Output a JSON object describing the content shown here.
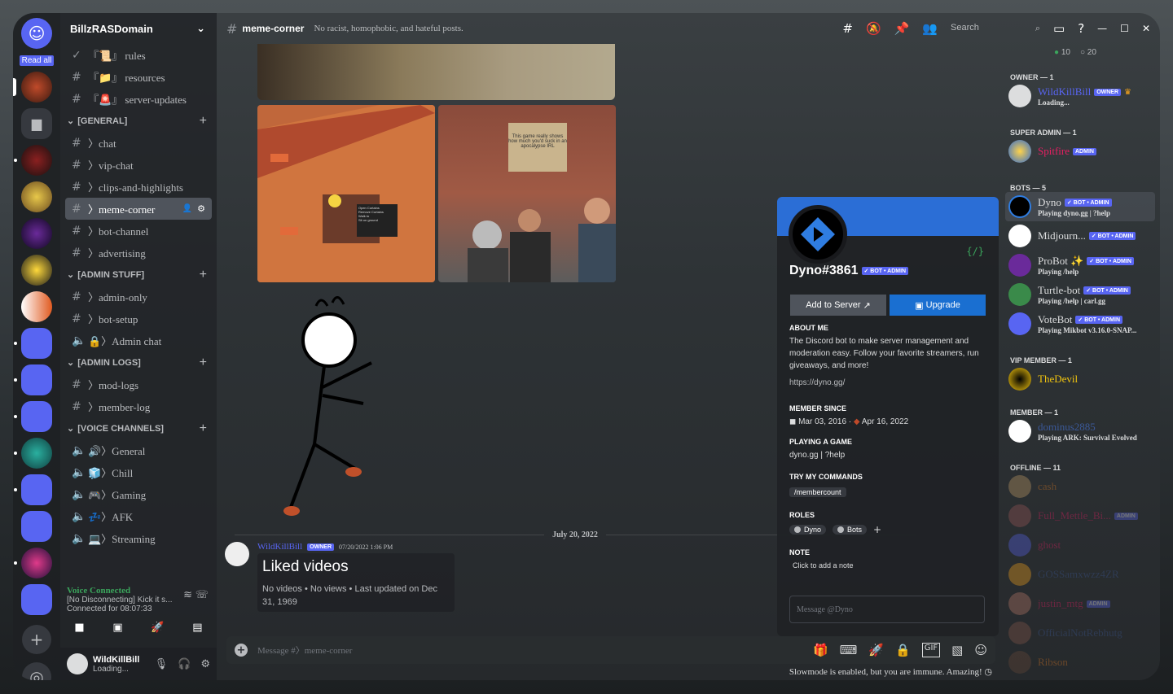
{
  "server_name": "BillzRASDomain",
  "read_all": "Read all",
  "channels_top": [
    {
      "icon": "✓",
      "label": "『📜』 rules"
    },
    {
      "icon": "#",
      "label": "『📁』 resources"
    },
    {
      "icon": "#",
      "label": "『🚨』 server-updates"
    }
  ],
  "cat_general": "[GENERAL]",
  "general": [
    "〉chat",
    "〉vip-chat",
    "〉clips-and-highlights",
    "〉meme-corner",
    "〉bot-channel",
    "〉advertising"
  ],
  "cat_admin": "[ADMIN STUFF]",
  "admin": [
    "〉admin-only",
    "〉bot-setup",
    "🔒〉Admin chat"
  ],
  "cat_logs": "[ADMIN LOGS]",
  "logs": [
    "〉mod-logs",
    "〉member-log"
  ],
  "cat_voice": "[VOICE CHANNELS]",
  "voice_channels": [
    "🔊〉General",
    "🧊〉Chill",
    "🎮〉Gaming",
    "💤〉AFK",
    "💻〉Streaming"
  ],
  "voice": {
    "status": "Voice Connected",
    "line1": "[No Disconnecting] Kick it s...",
    "line2": "Connected for 08:07:33"
  },
  "user": {
    "name": "WildKillBill",
    "status": "Loading..."
  },
  "topbar": {
    "channel": "meme-corner",
    "topic": "No racist, homophobic, and hateful posts.",
    "search": "Search"
  },
  "img_menu": [
    "Open Curtains",
    "Remove Curtains",
    "Walk to",
    "Sit on ground"
  ],
  "sign_text": "This game really shows how much you'd suck in an apocalypse IRL",
  "date_divider": "July 20, 2022",
  "message": {
    "author": "WildKillBill",
    "tag": "OWNER",
    "time": "07/20/2022 1:06 PM",
    "card_title": "Liked videos",
    "card_sub": "No videos • No views • Last updated on Dec 31, 1969"
  },
  "composer": {
    "placeholder": "Message #〉meme-corner",
    "slowmode": "Slowmode is enabled, but you are immune. Amazing!"
  },
  "profile": {
    "name": "Dyno#3861",
    "tag": "✓ BOT • ADMIN",
    "add": "Add to Server",
    "upgrade": "Upgrade",
    "about_t": "ABOUT ME",
    "about": "The Discord bot to make server management and moderation easy. Follow your favorite streamers, run giveaways, and more!",
    "link": "https://dyno.gg/",
    "since_t": "MEMBER SINCE",
    "since1": "Mar 03, 2016",
    "since2": "Apr 16, 2022",
    "game_t": "PLAYING A GAME",
    "game": "dyno.gg | ?help",
    "cmd_t": "TRY MY COMMANDS",
    "cmd": "/membercount",
    "roles_t": "ROLES",
    "roles": [
      "Dyno",
      "Bots"
    ],
    "note_t": "NOTE",
    "note": "Click to add a note",
    "msg": "Message @Dyno"
  },
  "counts": {
    "online": "10",
    "total": "20"
  },
  "members": {
    "owner_h": "OWNER — 1",
    "super_h": "SUPER ADMIN — 1",
    "bots_h": "BOTS — 5",
    "vip_h": "VIP MEMBER — 1",
    "member_h": "MEMBER — 1",
    "offline_h": "OFFLINE — 11",
    "owner": {
      "name": "WildKillBill",
      "tag": "OWNER",
      "status": "Loading..."
    },
    "super": {
      "name": "Spitfire",
      "tag": "ADMIN"
    },
    "bots": [
      {
        "name": "Dyno",
        "tag": "✓ BOT • ADMIN",
        "status": "Playing dyno.gg | ?help"
      },
      {
        "name": "Midjourn...",
        "tag": "✓ BOT • ADMIN",
        "status": ""
      },
      {
        "name": "ProBot ✨",
        "tag": "✓ BOT • ADMIN",
        "status": "Playing /help"
      },
      {
        "name": "Turtle-bot",
        "tag": "✓ BOT • ADMIN",
        "status": "Playing /help | carl.gg"
      },
      {
        "name": "VoteBot",
        "tag": "✓ BOT • ADMIN",
        "status": "Playing Mikbot v3.16.0-SNAP..."
      }
    ],
    "vip": {
      "name": "TheDevil"
    },
    "member": {
      "name": "dominus2885",
      "status": "Playing ARK: Survival Evolved"
    },
    "offline": [
      {
        "name": "cash",
        "tag": ""
      },
      {
        "name": "Full_Mettle_Bi...",
        "tag": "ADMIN"
      },
      {
        "name": "ghost",
        "tag": ""
      },
      {
        "name": "GOSSamxwzz4ZR",
        "tag": ""
      },
      {
        "name": "justin_mtg",
        "tag": "ADMIN"
      },
      {
        "name": "OfficialNotRebhutg",
        "tag": ""
      },
      {
        "name": "Ribson",
        "tag": ""
      }
    ]
  },
  "colors": {
    "accent": "#5865f2",
    "bg": "#2f3136",
    "online": "#3ba55c",
    "spitfire": "#e91e63",
    "vip": "#f1c40f"
  }
}
